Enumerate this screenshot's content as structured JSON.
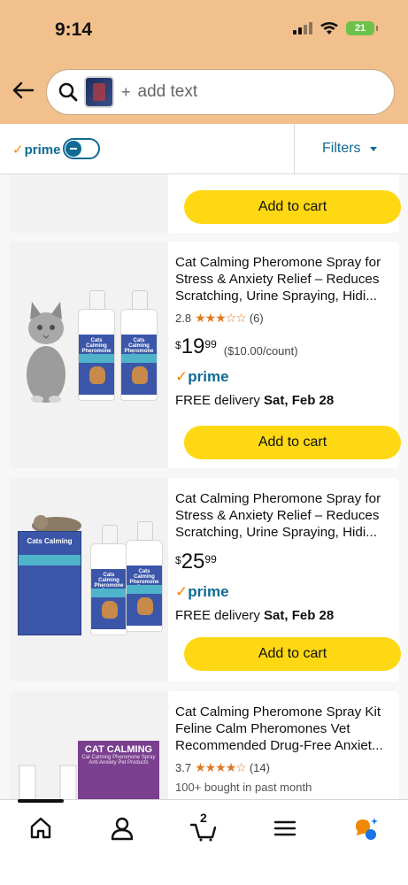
{
  "status": {
    "time": "9:14",
    "battery": "21"
  },
  "search": {
    "plus": "+",
    "placeholder": "add text"
  },
  "filter_bar": {
    "prime_label": "prime",
    "filters_label": "Filters"
  },
  "colors": {
    "header_bg": "#f2c08c",
    "add_to_cart": "#ffd814",
    "link": "#0f6a94",
    "star": "#de7921"
  },
  "products": [
    {
      "add_to_cart": "Add to cart"
    },
    {
      "title": "Cat Calming Pheromone Spray for Stress & Anxiety Relief – Reduces Scratching, Urine Spraying, Hidi...",
      "rating": "2.8",
      "stars": "★★★☆☆",
      "reviews": "(6)",
      "price_symbol": "$",
      "price_whole": "19",
      "price_fraction": "99",
      "unit_price": "($10.00/count)",
      "prime": "prime",
      "delivery_prefix": "FREE delivery ",
      "delivery_date": "Sat, Feb 28",
      "add_to_cart": "Add to cart",
      "label_hdr": "Cats Calming Pheromone Spray"
    },
    {
      "title": "Cat Calming Pheromone Spray for Stress & Anxiety Relief – Reduces Scratching, Urine Spraying, Hidi...",
      "price_symbol": "$",
      "price_whole": "25",
      "price_fraction": "99",
      "prime": "prime",
      "delivery_prefix": "FREE delivery ",
      "delivery_date": "Sat, Feb 28",
      "add_to_cart": "Add to cart",
      "box_hdr": "Cats Calming",
      "label_hdr": "Cats Calming Pheromone Spray"
    },
    {
      "title": "Cat Calming Pheromone Spray Kit Feline Calm Pheromones Vet Recommended Drug-Free Anxiet...",
      "rating": "3.7",
      "stars": "★★★★☆",
      "reviews": "(14)",
      "bought": "100+ bought in past month",
      "box_hdr": "CAT CALMING",
      "box_sub": "Cat Calming Pheromone Spray Anti Anxiety Pet Products"
    }
  ],
  "tabbar": {
    "cart_count": "2"
  }
}
